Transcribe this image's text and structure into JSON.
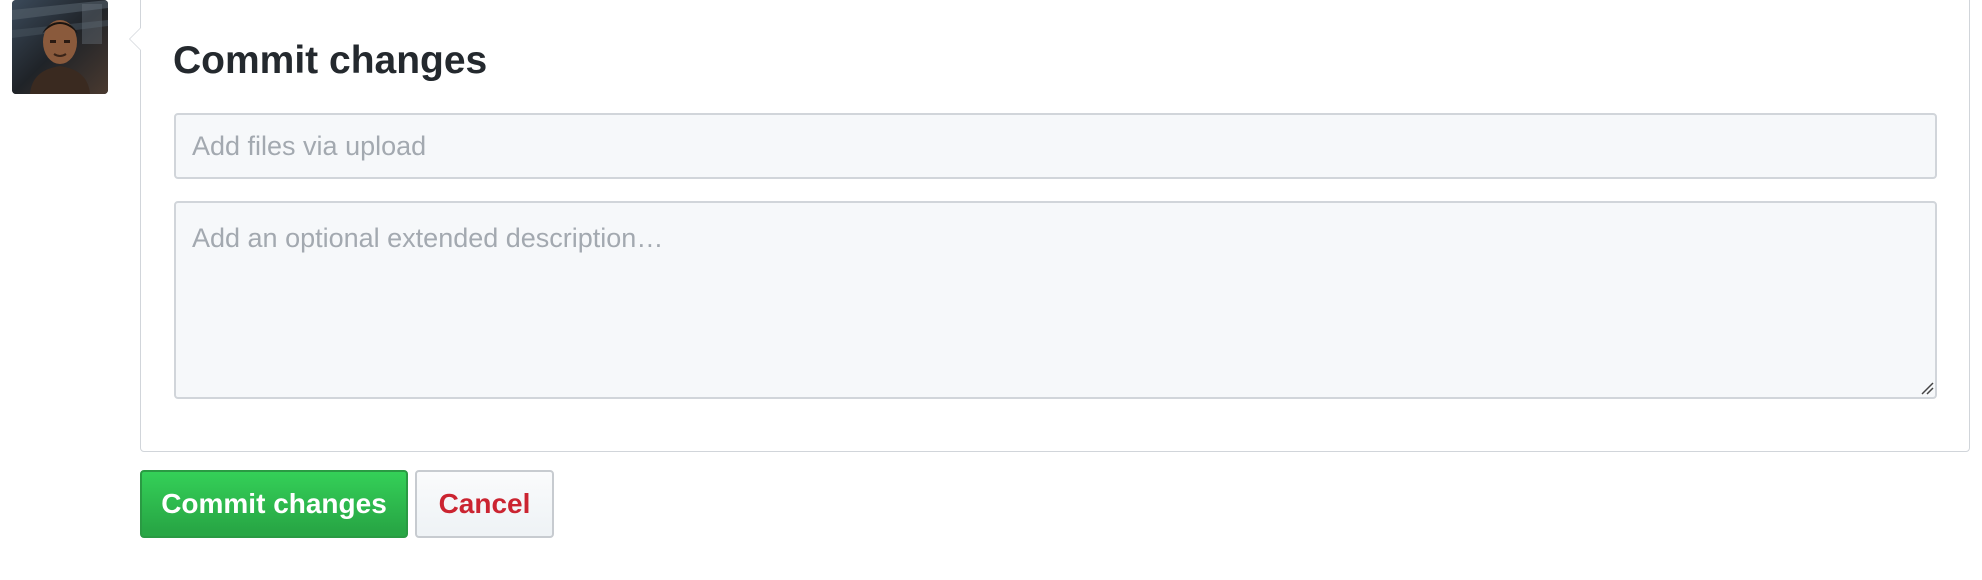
{
  "avatar": {
    "alt": "User avatar"
  },
  "commit_form": {
    "title": "Commit changes",
    "summary": {
      "value": "",
      "placeholder": "Add files via upload"
    },
    "description": {
      "value": "",
      "placeholder": "Add an optional extended description…"
    }
  },
  "actions": {
    "commit_label": "Commit changes",
    "cancel_label": "Cancel"
  },
  "colors": {
    "primary_button": "#28a745",
    "cancel_text": "#cb2431",
    "input_background": "#f6f8fa",
    "border": "#d1d5da"
  }
}
